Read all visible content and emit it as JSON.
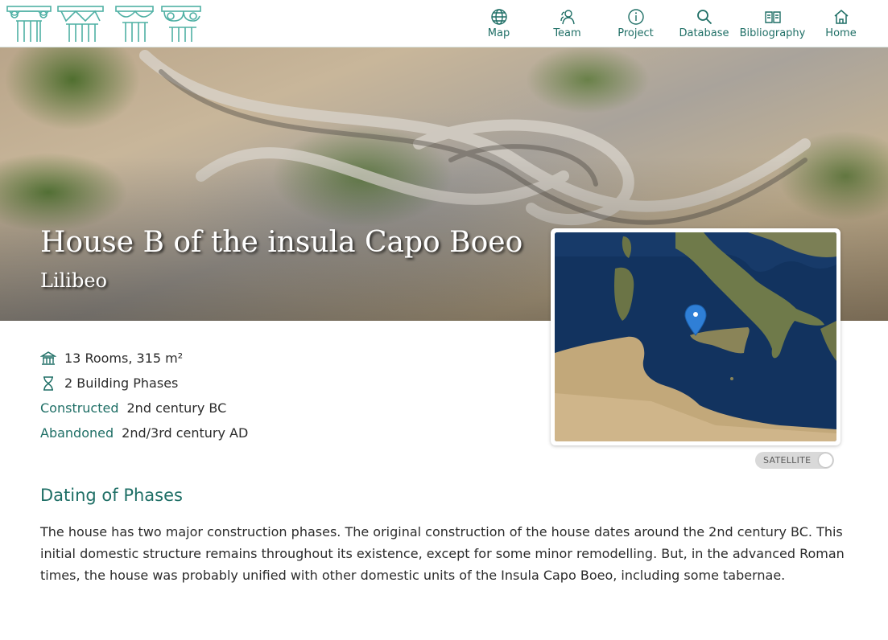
{
  "nav": {
    "items": [
      {
        "label": "Map",
        "icon": "globe-icon"
      },
      {
        "label": "Team",
        "icon": "team-icon"
      },
      {
        "label": "Project",
        "icon": "info-icon"
      },
      {
        "label": "Database",
        "icon": "search-icon"
      },
      {
        "label": "Bibliography",
        "icon": "book-icon"
      },
      {
        "label": "Home",
        "icon": "home-icon"
      }
    ]
  },
  "colors": {
    "accent": "#1f6f66",
    "text": "#2b2b2b",
    "toggle_bg": "#d9d9d9"
  },
  "hero": {
    "title": "House B of the insula Capo Boeo",
    "subtitle": "Lilibeo"
  },
  "facts": {
    "rooms": "13 Rooms, 315 m²",
    "phases": "2 Building Phases",
    "constructed_label": "Constructed",
    "constructed_value": "2nd century BC",
    "abandoned_label": "Abandoned",
    "abandoned_value": "2nd/3rd century AD"
  },
  "map": {
    "toggle_label": "SATELLITE",
    "marker_icon": "map-pin-icon"
  },
  "section": {
    "title": "Dating of Phases",
    "text": "The house has two major construction phases. The original construction of the house dates around the 2nd century BC. This initial domestic structure remains throughout its existence, except for some minor remodelling. But, in the advanced Roman times, the house was probably unified with other domestic units of the Insula Capo Boeo, including some tabernae."
  }
}
